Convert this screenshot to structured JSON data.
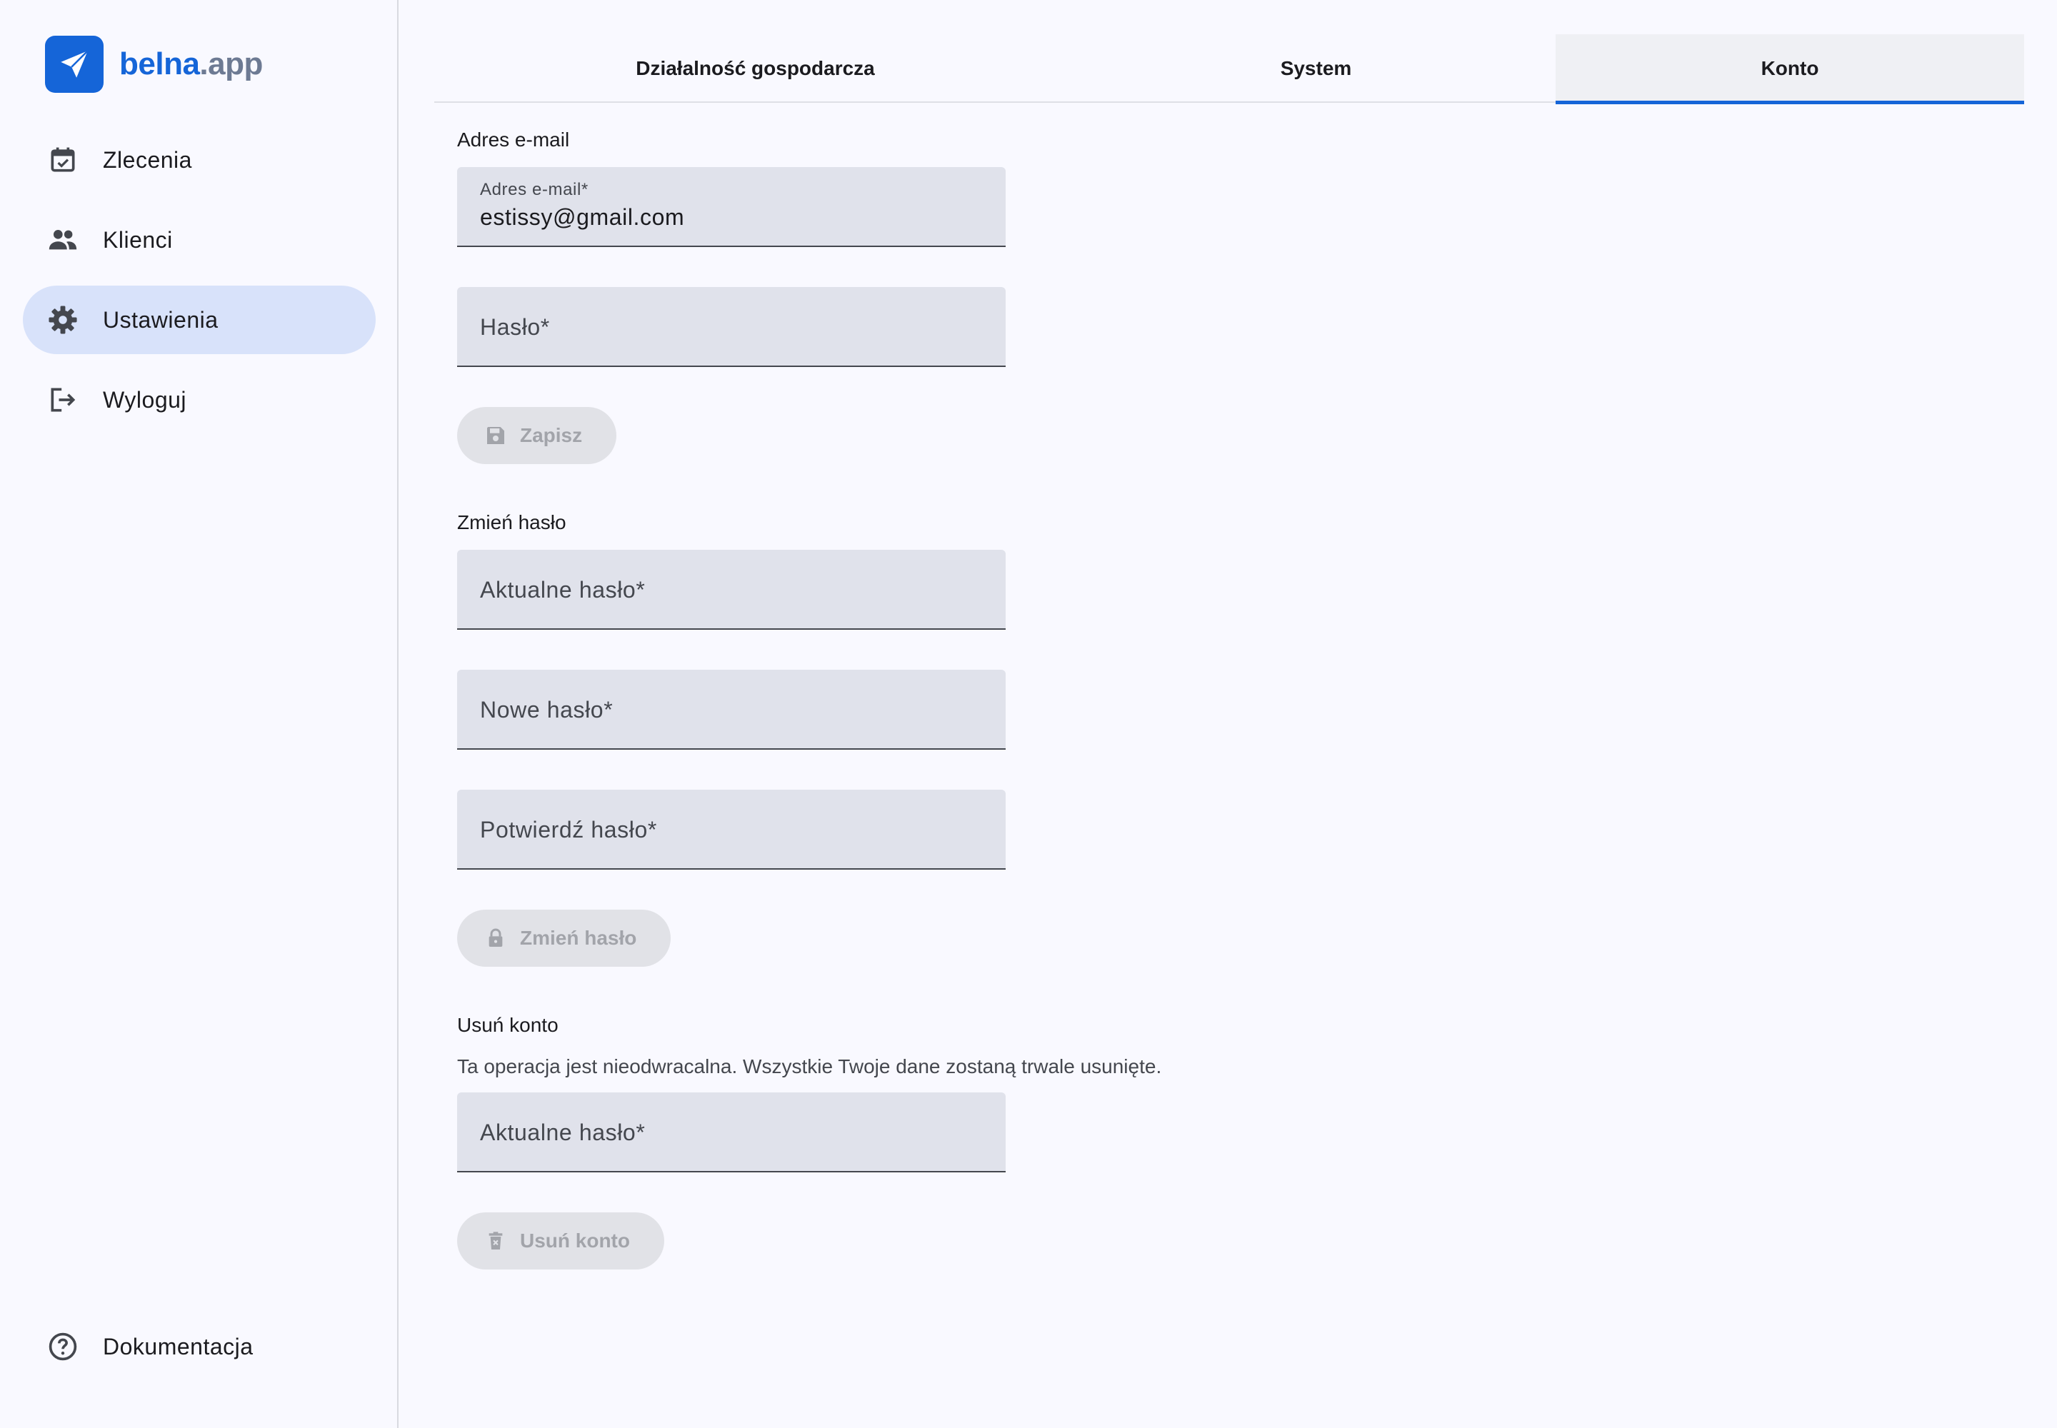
{
  "brand": {
    "name_primary": "belna",
    "name_secondary": ".app",
    "logo_icon": "paper-plane-icon",
    "logo_color": "#1565d8"
  },
  "sidebar": {
    "items": [
      {
        "label": "Zlecenia",
        "icon": "calendar-check-icon",
        "active": false
      },
      {
        "label": "Klienci",
        "icon": "people-icon",
        "active": false
      },
      {
        "label": "Ustawienia",
        "icon": "gear-icon",
        "active": true
      },
      {
        "label": "Wyloguj",
        "icon": "logout-icon",
        "active": false
      }
    ],
    "bottom_item": {
      "label": "Dokumentacja",
      "icon": "help-circle-icon"
    },
    "active_bg": "#d8e2fa"
  },
  "tabs": [
    {
      "label": "Działalność gospodarcza",
      "active": false
    },
    {
      "label": "System",
      "active": false
    },
    {
      "label": "Konto",
      "active": true
    }
  ],
  "email_section": {
    "title": "Adres e-mail",
    "email_label": "Adres e-mail*",
    "email_value": "estissy@gmail.com",
    "password_placeholder": "Hasło*",
    "save_label": "Zapisz",
    "save_icon": "floppy-disk-icon"
  },
  "change_password_section": {
    "title": "Zmień hasło",
    "current_placeholder": "Aktualne hasło*",
    "new_placeholder": "Nowe hasło*",
    "confirm_placeholder": "Potwierdź hasło*",
    "submit_label": "Zmień hasło",
    "submit_icon": "lock-icon"
  },
  "delete_account_section": {
    "title": "Usuń konto",
    "warning": "Ta operacja jest nieodwracalna. Wszystkie Twoje dane zostaną trwale usunięte.",
    "current_placeholder": "Aktualne hasło*",
    "submit_label": "Usuń konto",
    "submit_icon": "trash-icon"
  },
  "colors": {
    "accent": "#1565d8",
    "field_bg": "#e0e2eb",
    "disabled_text": "#a2a4aa"
  }
}
